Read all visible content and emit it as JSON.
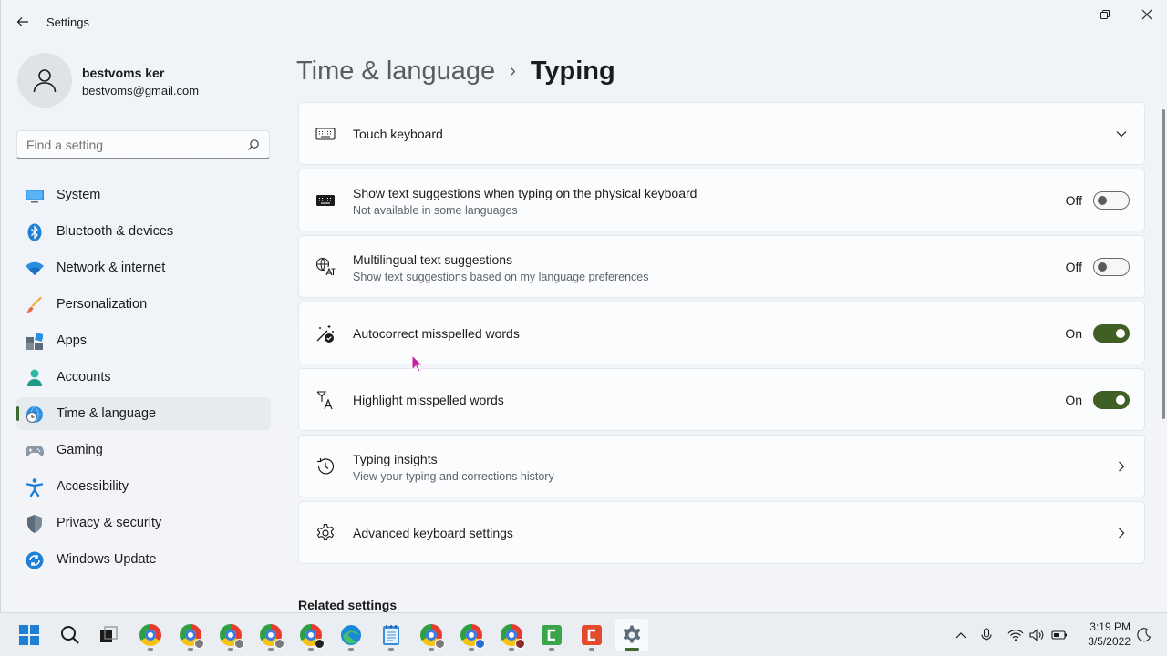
{
  "window": {
    "title": "Settings"
  },
  "profile": {
    "name": "bestvoms ker",
    "email": "bestvoms@gmail.com"
  },
  "search": {
    "placeholder": "Find a setting"
  },
  "nav": {
    "items": [
      {
        "label": "System",
        "icon": "monitor-icon"
      },
      {
        "label": "Bluetooth & devices",
        "icon": "bluetooth-icon"
      },
      {
        "label": "Network & internet",
        "icon": "wifi-icon"
      },
      {
        "label": "Personalization",
        "icon": "brush-icon"
      },
      {
        "label": "Apps",
        "icon": "apps-icon"
      },
      {
        "label": "Accounts",
        "icon": "person-icon"
      },
      {
        "label": "Time & language",
        "icon": "globe-clock-icon",
        "active": true
      },
      {
        "label": "Gaming",
        "icon": "gamepad-icon"
      },
      {
        "label": "Accessibility",
        "icon": "accessibility-icon"
      },
      {
        "label": "Privacy & security",
        "icon": "shield-icon"
      },
      {
        "label": "Windows Update",
        "icon": "update-icon"
      }
    ]
  },
  "header": {
    "parent": "Time & language",
    "separator": "›",
    "current": "Typing"
  },
  "cards": [
    {
      "title": "Touch keyboard",
      "subtitle": "",
      "icon": "keyboard-outline-icon",
      "control": "expand"
    },
    {
      "title": "Show text suggestions when typing on the physical keyboard",
      "subtitle": "Not available in some languages",
      "icon": "keyboard-filled-icon",
      "control": "toggle",
      "state": "Off"
    },
    {
      "title": "Multilingual text suggestions",
      "subtitle": "Show text suggestions based on my language preferences",
      "icon": "translate-icon",
      "control": "toggle",
      "state": "Off"
    },
    {
      "title": "Autocorrect misspelled words",
      "subtitle": "",
      "icon": "autocorrect-icon",
      "control": "toggle",
      "state": "On"
    },
    {
      "title": "Highlight misspelled words",
      "subtitle": "",
      "icon": "spellcheck-icon",
      "control": "toggle",
      "state": "On"
    },
    {
      "title": "Typing insights",
      "subtitle": "View your typing and corrections history",
      "icon": "history-icon",
      "control": "link"
    },
    {
      "title": "Advanced keyboard settings",
      "subtitle": "",
      "icon": "gear-icon",
      "control": "link"
    }
  ],
  "related": {
    "heading": "Related settings"
  },
  "colors": {
    "accent": "#3f5f25",
    "nav_active_bg": "#e6ebef"
  },
  "taskbar": {
    "apps": [
      "start-icon",
      "search-icon",
      "task-view-icon",
      "chrome-icon",
      "chrome-icon",
      "chrome-icon",
      "chrome-icon",
      "chrome-icon",
      "edge-icon",
      "notepad-icon",
      "chrome-icon",
      "chrome-icon",
      "chrome-icon",
      "camtasia-green-icon",
      "camtasia-red-icon",
      "settings-icon"
    ],
    "tray": [
      "chevron-up-icon",
      "microphone-icon",
      "wifi-icon",
      "volume-icon",
      "battery-icon",
      "moon-icon"
    ],
    "time": "3:19 PM",
    "date": "3/5/2022"
  }
}
